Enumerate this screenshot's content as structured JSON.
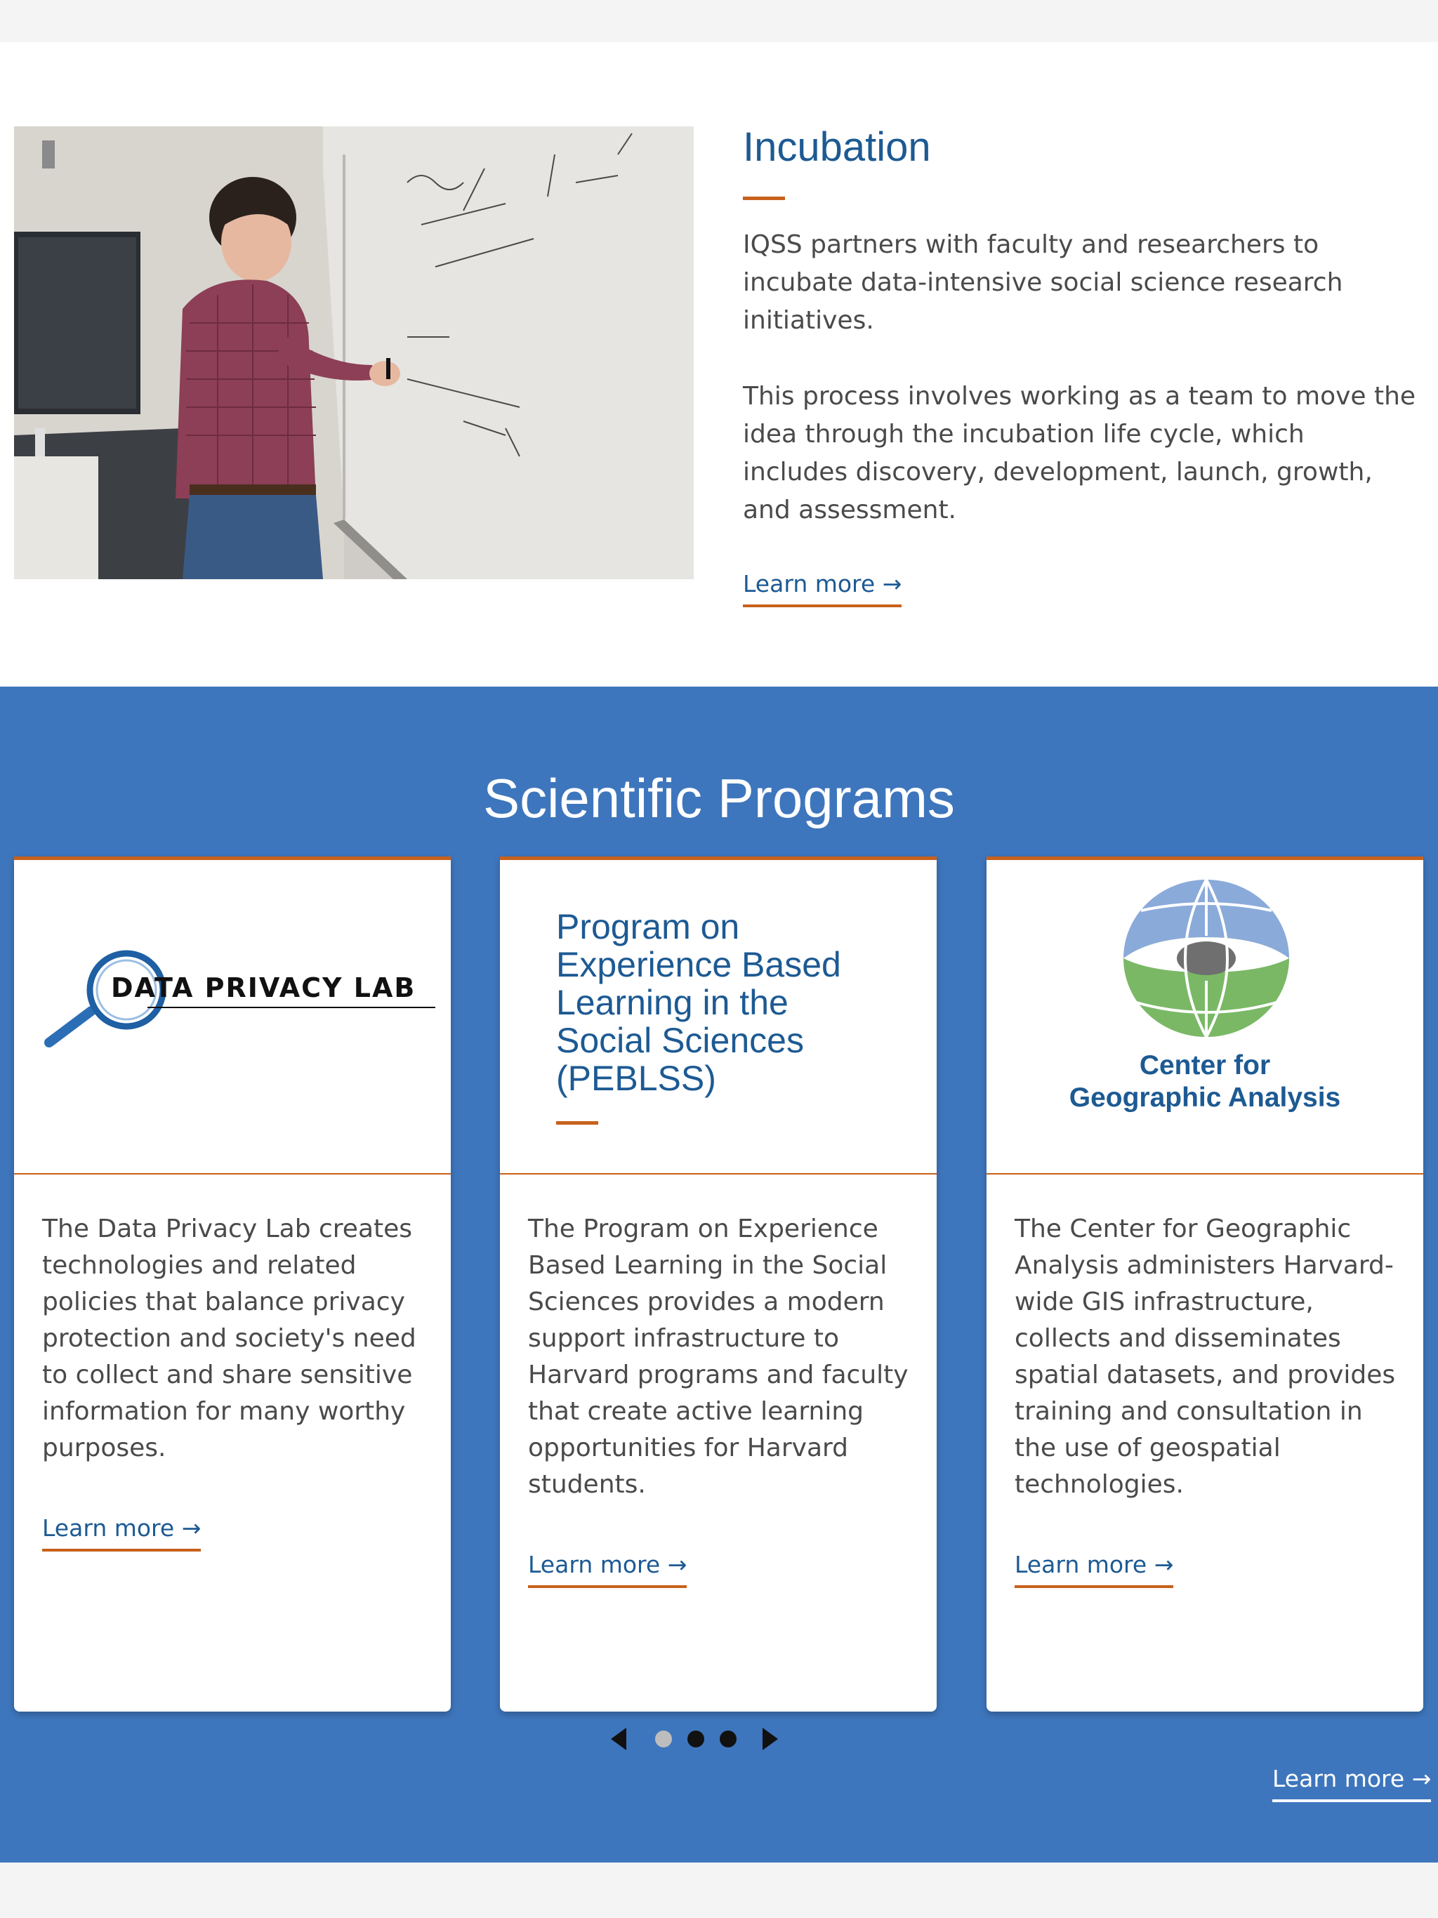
{
  "incubation": {
    "title": "Incubation",
    "paragraph1": "IQSS partners with faculty and researchers to incubate data-intensive social science research initiatives.",
    "paragraph2": "This process involves working as a team to move the idea through the incubation life cycle, which includes discovery, development, launch, growth, and assessment.",
    "learn_more": "Learn more →",
    "photo_icon": "person-writing-on-whiteboard-photo"
  },
  "programs": {
    "title": "Scientific Programs",
    "learn_more": "Learn more →",
    "cards": [
      {
        "logo_text": "DATA PRIVACY LAB",
        "logo_icon": "magnifying-glass-icon",
        "body": "The Data Privacy Lab creates technologies and related policies that balance privacy protection and society's need to collect and share sensitive information for many worthy purposes.",
        "learn_more": "Learn more →"
      },
      {
        "title": "Program on Experience Based Learning in the Social Sciences (PEBLSS)",
        "body": "The Program on Experience Based Learning in the Social Sciences provides a modern support infrastructure to Harvard programs and faculty that create active learning opportunities for Harvard students.",
        "learn_more": "Learn more →"
      },
      {
        "logo_line1": "Center for",
        "logo_line2": "Geographic Analysis",
        "logo_icon": "globe-icon",
        "body": "The Center for Geographic Analysis administers Harvard-wide GIS infrastructure, collects and disseminates spatial datasets, and provides training and consultation in the use of geospatial technologies.",
        "learn_more": "Learn more →"
      }
    ],
    "carousel": {
      "active_dot": 1,
      "dot_count": 3
    }
  },
  "colors": {
    "accent_orange": "#c8611c",
    "heading_blue": "#1d5a93",
    "section_blue": "#3e76bd"
  }
}
